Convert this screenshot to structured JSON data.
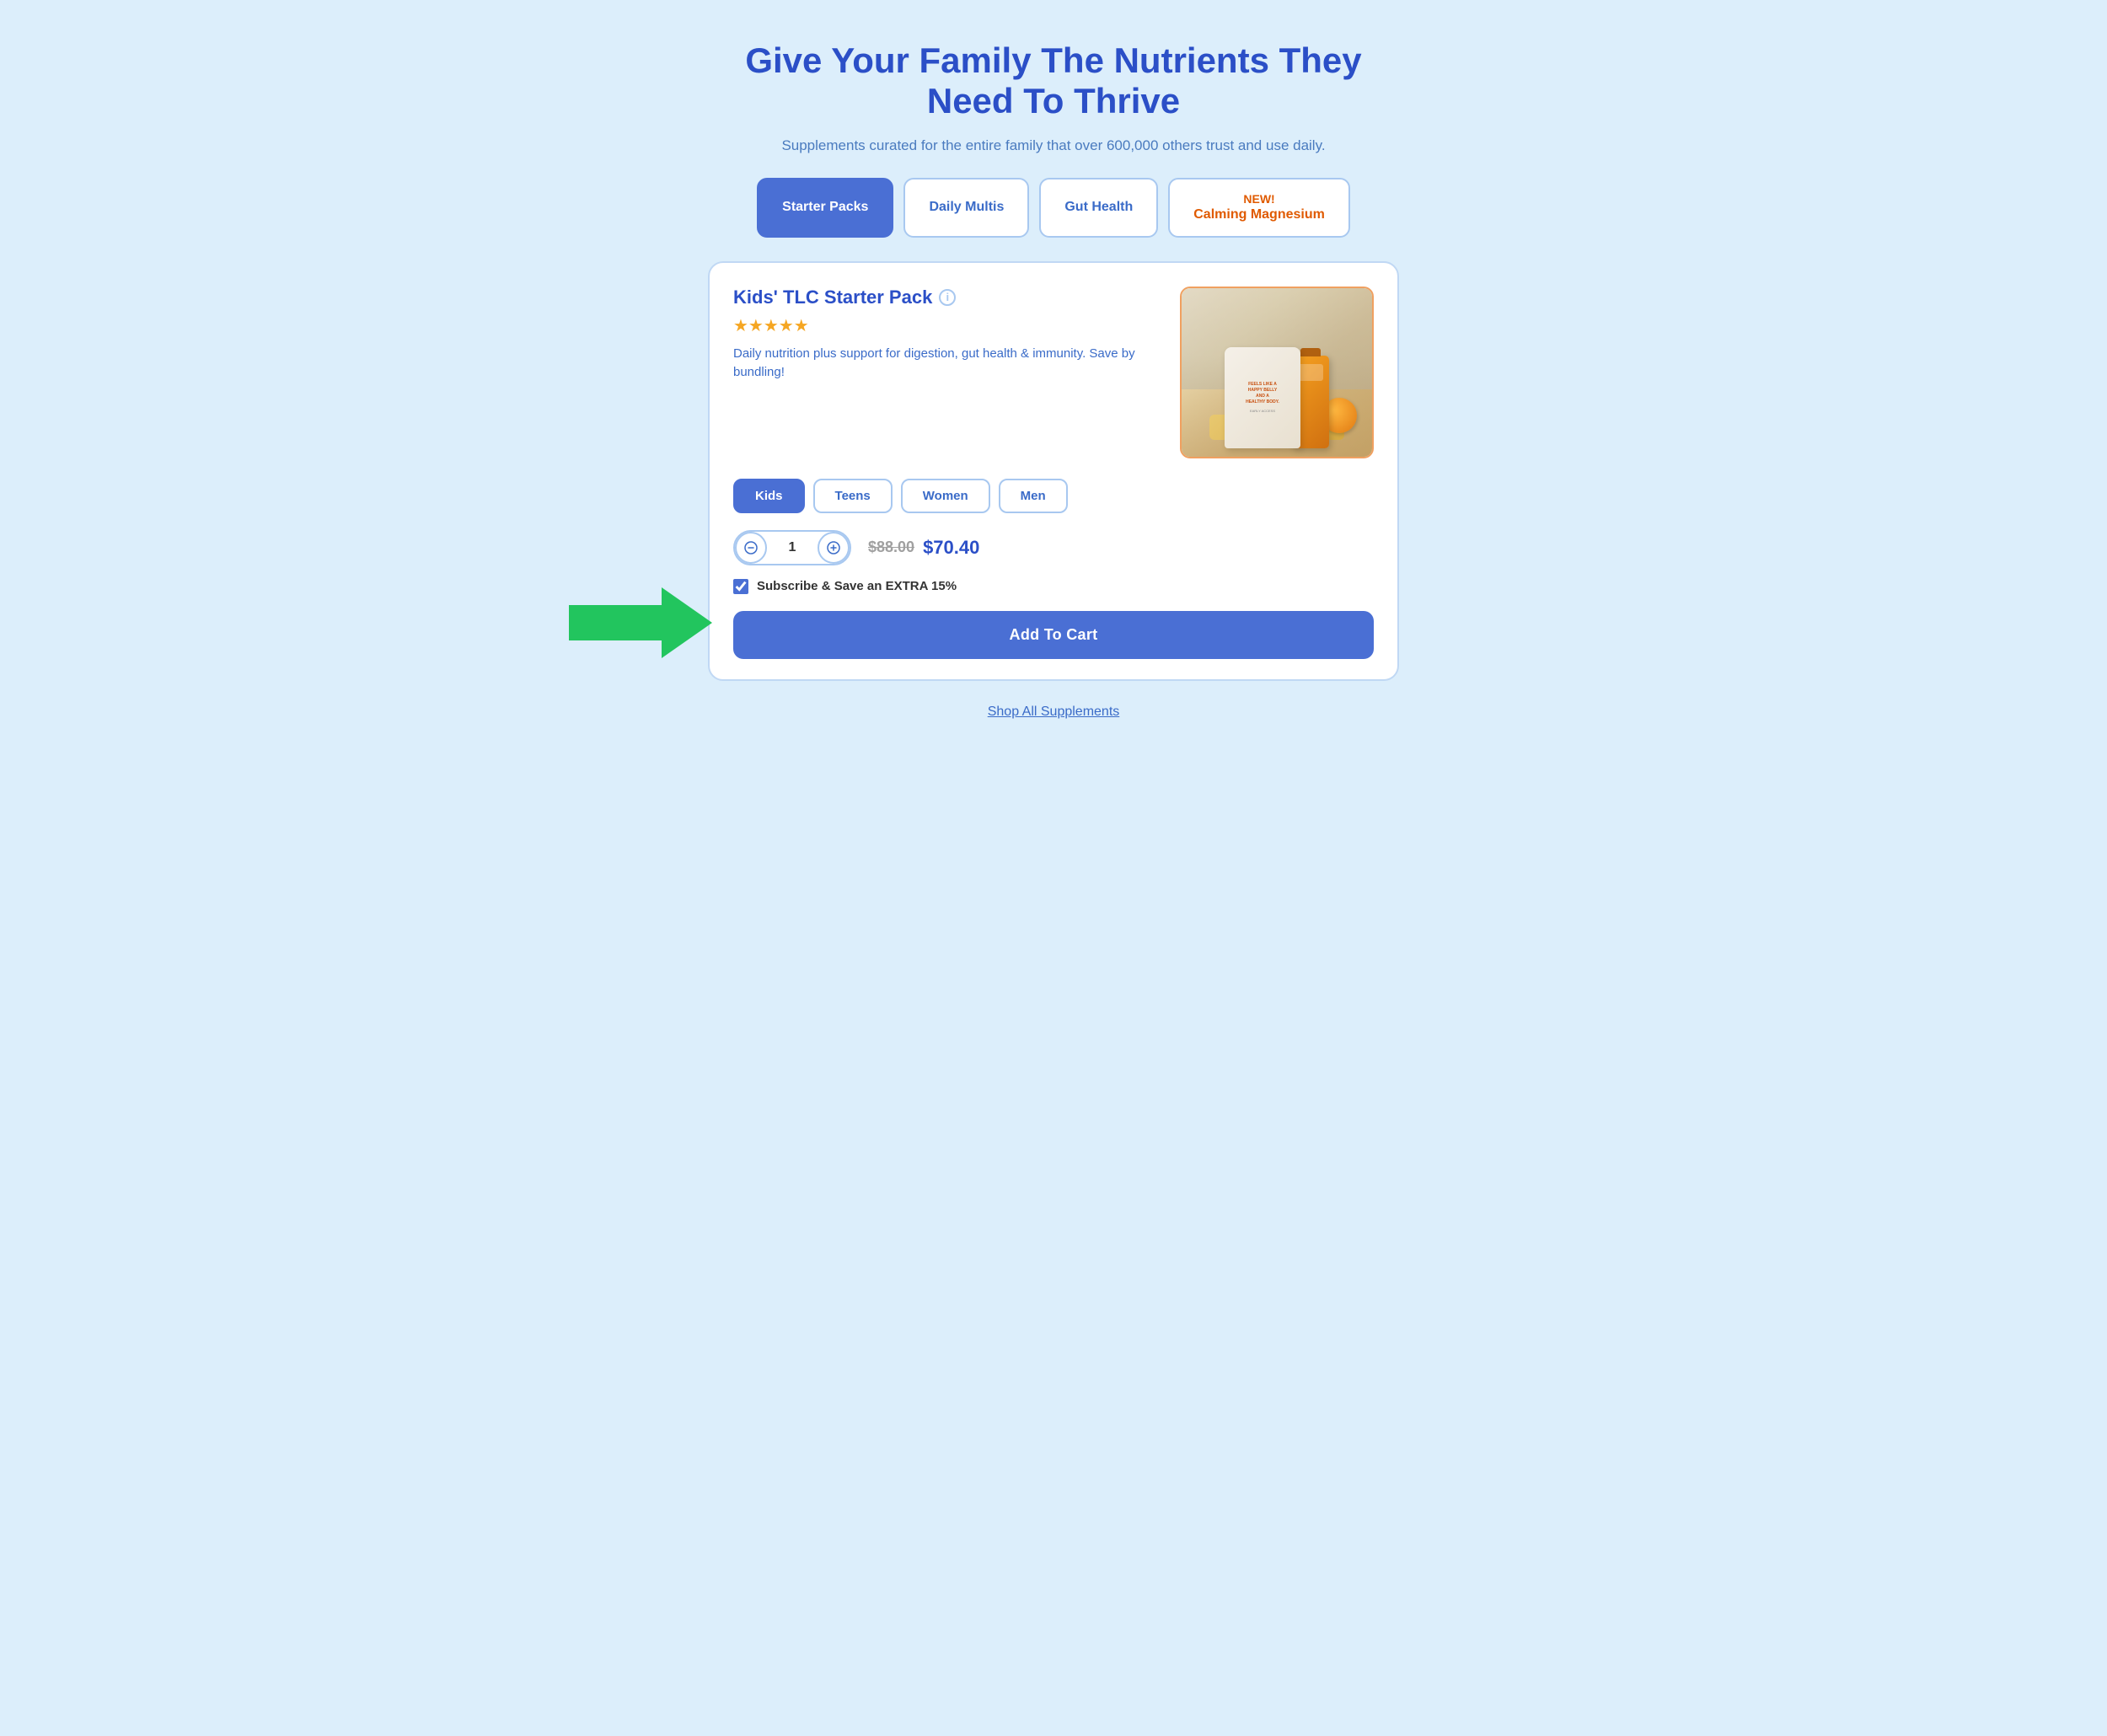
{
  "page": {
    "main_title": "Give Your Family The Nutrients They Need To Thrive",
    "subtitle": "Supplements curated for the entire family that over 600,000 others trust and use daily."
  },
  "tabs": [
    {
      "id": "starter-packs",
      "label": "Starter Packs",
      "active": true,
      "new": false
    },
    {
      "id": "daily-multis",
      "label": "Daily Multis",
      "active": false,
      "new": false
    },
    {
      "id": "gut-health",
      "label": "Gut Health",
      "active": false,
      "new": false
    },
    {
      "id": "calming-magnesium",
      "label_new": "NEW!",
      "label_main": "Calming\nMagnesium",
      "active": false,
      "new": true
    }
  ],
  "product": {
    "title": "Kids' TLC Starter Pack",
    "info_icon": "ⓘ",
    "stars": "★★★★★",
    "description": "Daily nutrition plus support for digestion, gut health & immunity. Save by bundling!",
    "variants": [
      {
        "label": "Kids",
        "active": true
      },
      {
        "label": "Teens",
        "active": false
      },
      {
        "label": "Women",
        "active": false
      },
      {
        "label": "Men",
        "active": false
      }
    ],
    "quantity": 1,
    "price_original": "$88.00",
    "price_sale": "$70.40",
    "subscribe_label": "Subscribe & Save an EXTRA 15%",
    "add_to_cart_label": "Add To Cart"
  },
  "footer": {
    "shop_link": "Shop All Supplements"
  }
}
